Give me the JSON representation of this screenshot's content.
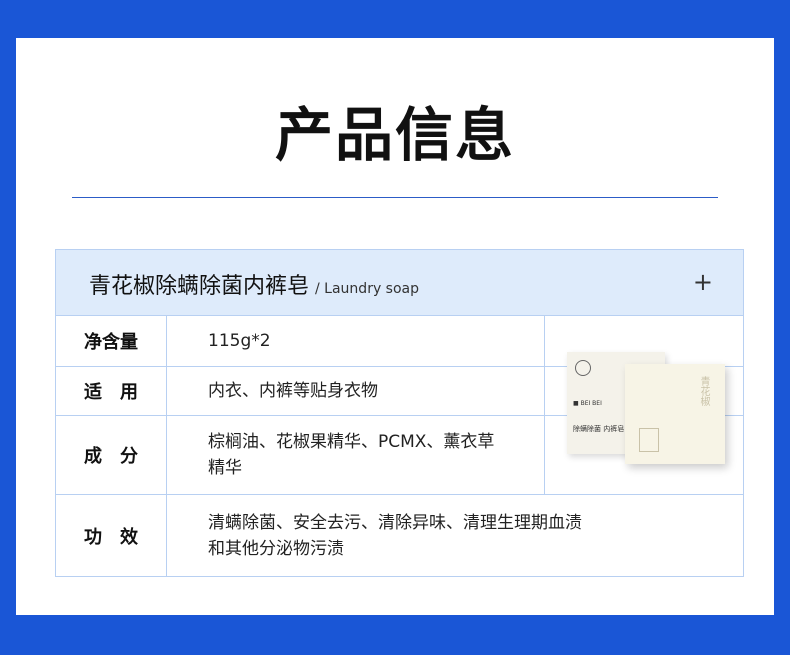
{
  "page": {
    "title": "产品信息"
  },
  "product": {
    "name": "青花椒除螨除菌内裤皂",
    "subtitle": "/ Laundry soap",
    "expand_symbol": "+"
  },
  "rows": [
    {
      "label": "净含量",
      "value_lines": [
        "115g*2"
      ]
    },
    {
      "label": "适　用",
      "value_lines": [
        "内衣、内裤等贴身衣物"
      ]
    },
    {
      "label": "成　分",
      "value_lines": [
        "棕榈油、花椒果精华、PCMX、薰衣草",
        "精华"
      ]
    },
    {
      "label": "功　效",
      "value_lines": [
        "清螨除菌、安全去污、清除异味、清理生理期血渍",
        "和其他分泌物污渍"
      ]
    }
  ],
  "image": {
    "box_brand": "■ BEI BEI",
    "box_text": "除螨除菌 内裤皂",
    "box_vertical": "青花椒"
  },
  "colors": {
    "background": "#1a56d6",
    "header": "#deebfb",
    "border": "#b8d0f2"
  }
}
